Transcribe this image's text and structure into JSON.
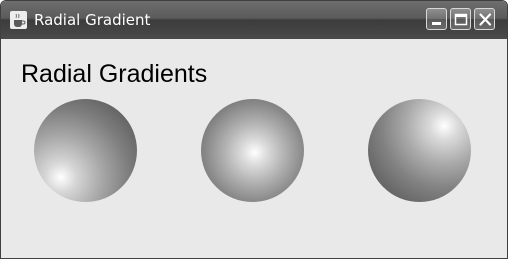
{
  "window": {
    "title": "Radial Gradient"
  },
  "content": {
    "heading": "Radial Gradients"
  },
  "icons": {
    "app": "java-cup-icon",
    "minimize": "minimize-icon",
    "maximize": "maximize-icon",
    "close": "close-icon"
  },
  "spheres": [
    {
      "name": "sphere-bottom-left-highlight",
      "highlight": "bottom-left"
    },
    {
      "name": "sphere-center-highlight",
      "highlight": "center"
    },
    {
      "name": "sphere-top-right-highlight",
      "highlight": "top-right"
    }
  ],
  "colors": {
    "titlebar": "#4a4a4a",
    "content_background": "#e9e9e9",
    "highlight": "#ffffff",
    "shade": "#5d5d5d"
  }
}
